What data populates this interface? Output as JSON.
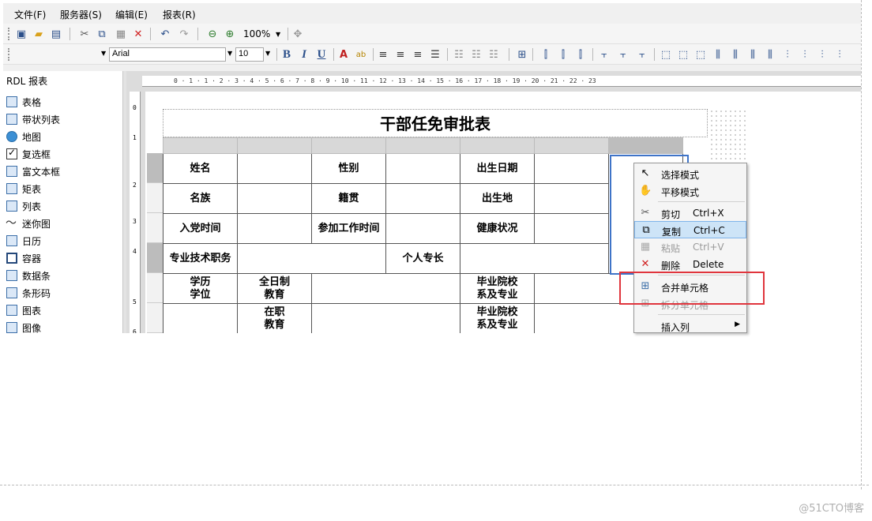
{
  "menubar": [
    "文件(F)",
    "服务器(S)",
    "编辑(E)",
    "报表(R)"
  ],
  "toolbar": {
    "zoom": "100%",
    "font_name": "Arial",
    "font_size": "10",
    "bold": "B",
    "italic": "I",
    "underline": "U"
  },
  "panel": {
    "title": "RDL 报表",
    "items": [
      {
        "label": "表格",
        "icon": "table-icon"
      },
      {
        "label": "带状列表",
        "icon": "banded-list-icon"
      },
      {
        "label": "地图",
        "icon": "map-icon"
      },
      {
        "label": "复选框",
        "icon": "checkbox-icon"
      },
      {
        "label": "富文本框",
        "icon": "richtext-icon"
      },
      {
        "label": "矩表",
        "icon": "matrix-icon"
      },
      {
        "label": "列表",
        "icon": "list-icon"
      },
      {
        "label": "迷你图",
        "icon": "sparkline-icon"
      },
      {
        "label": "日历",
        "icon": "calendar-icon"
      },
      {
        "label": "容器",
        "icon": "container-icon"
      },
      {
        "label": "数据条",
        "icon": "databar-icon"
      },
      {
        "label": "条形码",
        "icon": "barcode-icon"
      },
      {
        "label": "图表",
        "icon": "chart-icon"
      },
      {
        "label": "图像",
        "icon": "image-icon"
      }
    ]
  },
  "ruler": {
    "top": "0 · 1 · 1 · 2 · 3 · 4 · 5 · 6 · 7 · 8 · 9 · 10 · 11 · 12 · 13 · 14 · 15 · 16 · 17 · 18 · 19 · 20 · 21 · 22 · 23",
    "left": [
      "0",
      "1",
      "2",
      "3",
      "4",
      "5",
      "6"
    ]
  },
  "report": {
    "title": "干部任免审批表",
    "rows": [
      [
        "姓名",
        "",
        "性别",
        "",
        "出生日期",
        "",
        ""
      ],
      [
        "名族",
        "",
        "籍贯",
        "",
        "出生地",
        "",
        ""
      ],
      [
        "入党时间",
        "",
        "参加工作时间",
        "",
        "健康状况",
        "",
        ""
      ],
      [
        "专业技术职务",
        "",
        "",
        "个人专长",
        "",
        "",
        ""
      ],
      [
        "学历\n学位",
        "全日制\n教育",
        "",
        "",
        "毕业院校\n系及专业",
        "",
        ""
      ],
      [
        "",
        "在职\n教育",
        "",
        "",
        "毕业院校\n系及专业",
        "",
        ""
      ]
    ]
  },
  "context_menu": {
    "items": [
      {
        "label": "选择模式",
        "shortcut": "",
        "icon": "cursor-icon",
        "state": "normal"
      },
      {
        "label": "平移模式",
        "shortcut": "",
        "icon": "hand-icon",
        "state": "normal"
      },
      {
        "label": "剪切",
        "shortcut": "Ctrl+X",
        "icon": "scissors-icon",
        "state": "normal"
      },
      {
        "label": "复制",
        "shortcut": "Ctrl+C",
        "icon": "copy-icon",
        "state": "highlighted"
      },
      {
        "label": "粘贴",
        "shortcut": "Ctrl+V",
        "icon": "paste-icon",
        "state": "disabled"
      },
      {
        "label": "删除",
        "shortcut": "Delete",
        "icon": "delete-icon",
        "state": "normal"
      },
      {
        "label": "合并单元格",
        "shortcut": "",
        "icon": "merge-cells-icon",
        "state": "normal"
      },
      {
        "label": "拆分单元格",
        "shortcut": "",
        "icon": "split-cells-icon",
        "state": "disabled"
      },
      {
        "label": "插入列",
        "shortcut": "",
        "icon": "",
        "state": "submenu"
      }
    ]
  },
  "watermark": "@51CTO博客",
  "colors": {
    "selection_border": "#3f74c8",
    "annotation_box": "#e0353d",
    "menu_highlight": "#cde4f7"
  }
}
